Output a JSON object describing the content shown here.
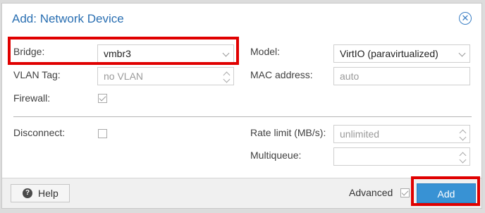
{
  "dialog": {
    "title": "Add: Network Device"
  },
  "left_fields": {
    "bridge": {
      "label": "Bridge:",
      "value": "vmbr3"
    },
    "vlan": {
      "label": "VLAN Tag:",
      "value": "no VLAN"
    },
    "firewall": {
      "label": "Firewall:",
      "checked": true
    }
  },
  "right_fields": {
    "model": {
      "label": "Model:",
      "value": "VirtIO (paravirtualized)"
    },
    "mac": {
      "label": "MAC address:",
      "value": "auto"
    }
  },
  "advanced_fields": {
    "disconnect": {
      "label": "Disconnect:",
      "checked": false
    },
    "rate_limit": {
      "label": "Rate limit (MB/s):",
      "value": "unlimited"
    },
    "multiqueue": {
      "label": "Multiqueue:",
      "value": ""
    }
  },
  "footer": {
    "help_label": "Help",
    "help_icon": "?",
    "advanced_label": "Advanced",
    "advanced_checked": true,
    "add_label": "Add"
  },
  "colors": {
    "accent": "#3892d4",
    "title": "#2a6fb2",
    "highlight": "#e00000"
  }
}
